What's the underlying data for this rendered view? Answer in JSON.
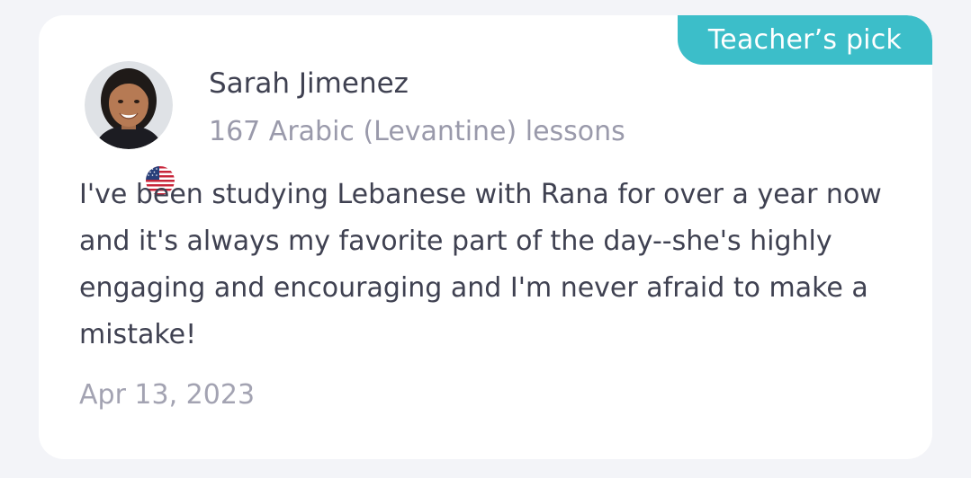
{
  "review": {
    "badge": "Teacher’s pick",
    "reviewer_name": "Sarah Jimenez",
    "lessons": "167 Arabic (Levantine) lessons",
    "text": "I've been studying Lebanese with Rana for over a year now and it's always my favorite part of the day--she's highly engaging and encouraging and I'm never afraid to make a mistake!",
    "date": "Apr 13, 2023",
    "country_flag": "us-flag-icon"
  },
  "colors": {
    "badge_bg": "#3cbec9",
    "page_bg": "#f3f4f8",
    "card_bg": "#ffffff",
    "primary_text": "#3f4151",
    "muted_text": "#9a9aab"
  }
}
